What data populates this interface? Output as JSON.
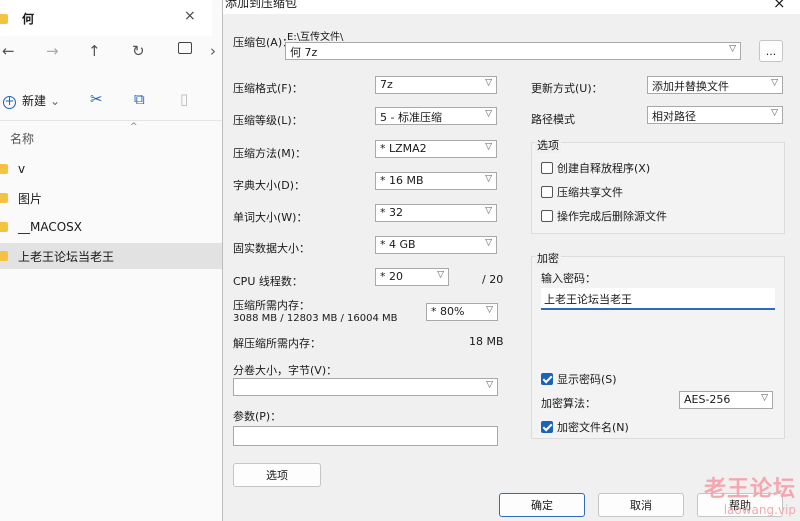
{
  "explorer": {
    "tab_title": "何",
    "tab_close": "×",
    "nav": {
      "back": "←",
      "forward": "→",
      "up": "↑",
      "refresh": "↻",
      "more": "›"
    },
    "cmd": {
      "new_label": "新建",
      "new_caret": "⌄"
    },
    "column_header": "名称",
    "items": [
      {
        "label": "v",
        "selected": false
      },
      {
        "label": "图片",
        "selected": false
      },
      {
        "label": "__MACOSX",
        "selected": false
      },
      {
        "label": "上老王论坛当老王",
        "selected": true
      }
    ]
  },
  "dialog": {
    "title": "添加到压缩包",
    "close": "×",
    "archive_label": "压缩包(A)：",
    "archive_path": "E:\\互传文件\\",
    "archive_name": "何 7z",
    "browse_label": "...",
    "left_fields": [
      {
        "label": "压缩格式(F)：",
        "value": "7z"
      },
      {
        "label": "压缩等级(L)：",
        "value": "5 - 标准压缩"
      },
      {
        "label": "压缩方法(M)：",
        "value": "*  LZMA2"
      },
      {
        "label": "字典大小(D)：",
        "value": "*  16 MB"
      },
      {
        "label": "单词大小(W)：",
        "value": "*  32"
      },
      {
        "label": "固实数据大小：",
        "value": "*  4 GB"
      }
    ],
    "cpu_label": "CPU 线程数：",
    "cpu_value": "*  20",
    "cpu_total": "/ 20",
    "mem_label": "压缩所需内存：",
    "mem_detail": "3088 MB / 12803 MB / 16004 MB",
    "mem_percent": "* 80%",
    "decomp_label": "解压缩所需内存：",
    "decomp_value": "18 MB",
    "split_label": "分卷大小，字节(V)：",
    "split_value": "",
    "params_label": "参数(P)：",
    "options_button": "选项",
    "update_label": "更新方式(U)：",
    "update_value": "添加并替换文件",
    "path_label": "路径模式",
    "path_value": "相对路径",
    "options_group": {
      "title": "选项",
      "checks": [
        {
          "label": "创建自释放程序(X)",
          "checked": false
        },
        {
          "label": "压缩共享文件",
          "checked": false
        },
        {
          "label": "操作完成后删除源文件",
          "checked": false
        }
      ]
    },
    "encrypt_group": {
      "title": "加密",
      "pwd_label": "输入密码：",
      "pwd_value": "上老王论坛当老王",
      "show_pwd": {
        "label": "显示密码(S)",
        "checked": true
      },
      "algo_label": "加密算法：",
      "algo_value": "AES-256",
      "enc_names": {
        "label": "加密文件名(N)",
        "checked": true
      }
    },
    "ok": "确定",
    "cancel": "取消",
    "help": "帮助"
  },
  "watermark": {
    "cn": "老王论坛",
    "en": "laowang.vip"
  },
  "colors": {
    "accent": "#2f6cb5",
    "folder": "#f5c242",
    "watermark": "#f3a8b0"
  }
}
